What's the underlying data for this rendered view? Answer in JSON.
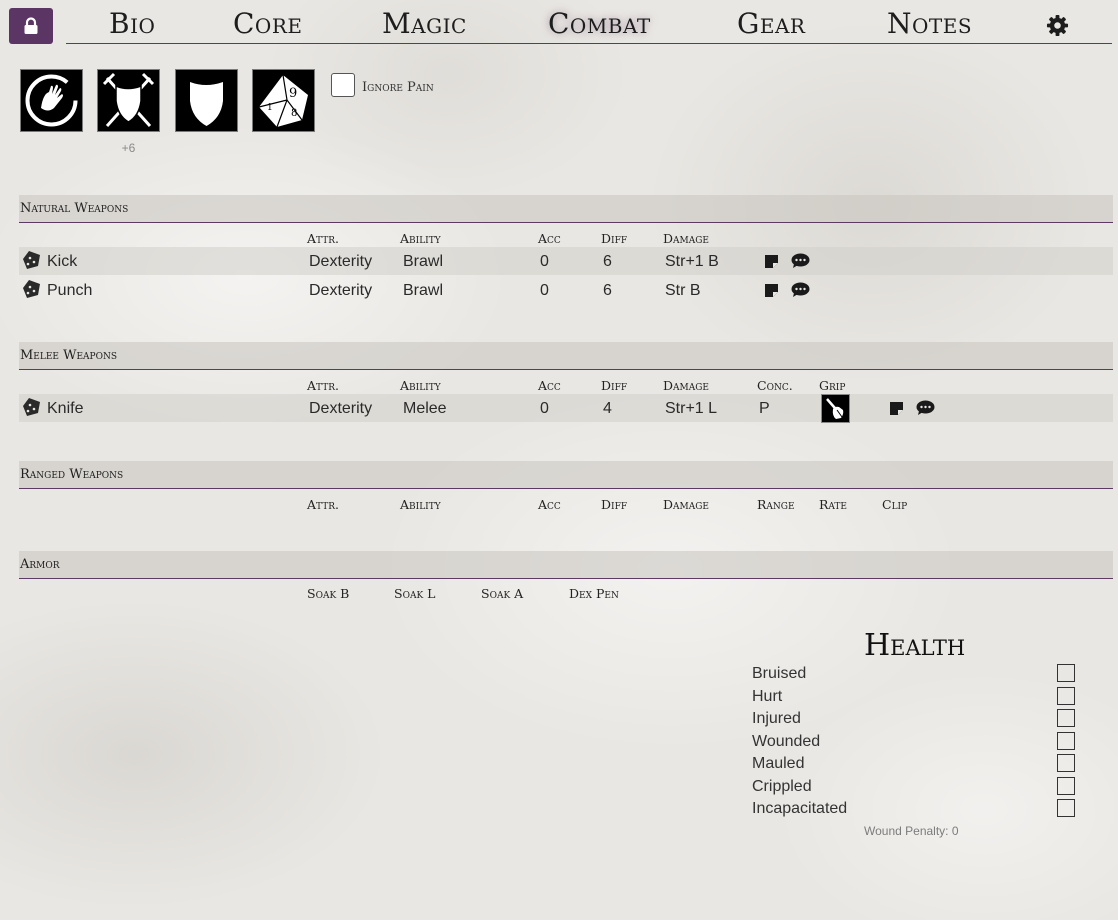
{
  "nav": {
    "tabs": [
      "Bio",
      "Core",
      "Magic",
      "Combat",
      "Gear",
      "Notes"
    ],
    "active_tab": "Combat"
  },
  "icons": {
    "items": [
      "hand-circle-icon",
      "crossed-swords-shield-icon",
      "shield-icon",
      "d10-dice-icon"
    ],
    "bonus": "+6",
    "ignore_pain_label": "Ignore Pain",
    "ignore_pain_checked": false
  },
  "natural_weapons": {
    "title": "Natural Weapons",
    "columns": [
      "Attr.",
      "Ability",
      "Acc",
      "Diff",
      "Damage"
    ],
    "rows": [
      {
        "name": "Kick",
        "attr": "Dexterity",
        "ability": "Brawl",
        "acc": "0",
        "diff": "6",
        "damage": "Str+1 B"
      },
      {
        "name": "Punch",
        "attr": "Dexterity",
        "ability": "Brawl",
        "acc": "0",
        "diff": "6",
        "damage": "Str B"
      }
    ]
  },
  "melee_weapons": {
    "title": "Melee Weapons",
    "columns": [
      "Attr.",
      "Ability",
      "Acc",
      "Diff",
      "Damage",
      "Conc.",
      "Grip"
    ],
    "rows": [
      {
        "name": "Knife",
        "attr": "Dexterity",
        "ability": "Melee",
        "acc": "0",
        "diff": "4",
        "damage": "Str+1 L",
        "conc": "P",
        "grip_icon": "one-hand-grip-icon"
      }
    ]
  },
  "ranged_weapons": {
    "title": "Ranged Weapons",
    "columns": [
      "Attr.",
      "Ability",
      "Acc",
      "Diff",
      "Damage",
      "Range",
      "Rate",
      "Clip"
    ]
  },
  "armor": {
    "title": "Armor",
    "columns": [
      "Soak B",
      "Soak L",
      "Soak A",
      "Dex Pen"
    ]
  },
  "health": {
    "title": "Health",
    "levels": [
      "Bruised",
      "Hurt",
      "Injured",
      "Wounded",
      "Mauled",
      "Crippled",
      "Incapacitated"
    ],
    "wound_penalty": "Wound Penalty: 0"
  },
  "colors": {
    "accent": "#5b3563",
    "rule": "#5d3a63",
    "parchment": "#e9e7e3"
  }
}
